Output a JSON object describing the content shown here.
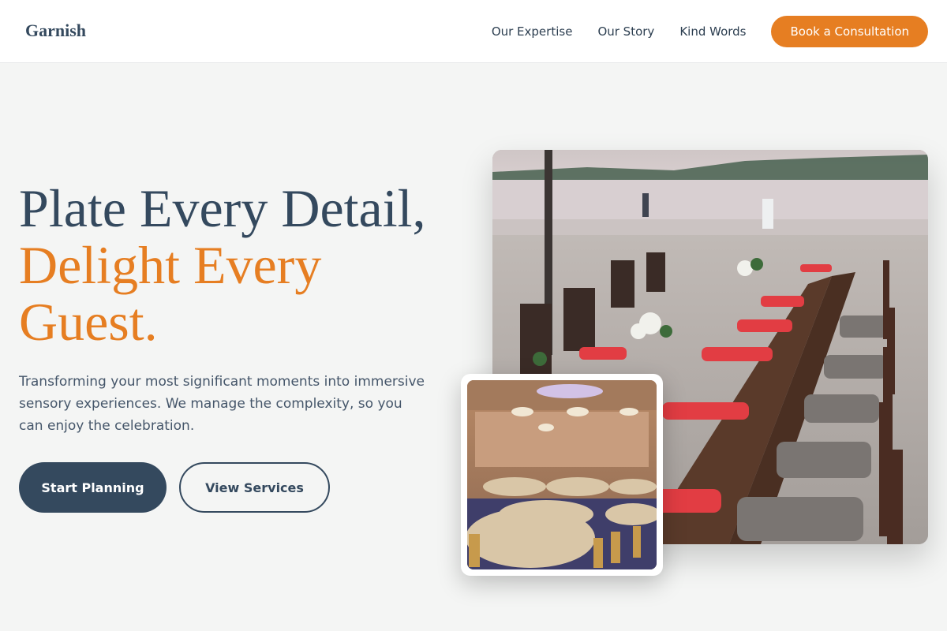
{
  "header": {
    "logo": "Garnish",
    "nav": [
      "Our Expertise",
      "Our Story",
      "Kind Words"
    ],
    "cta": "Book a Consultation"
  },
  "hero": {
    "title_line1": "Plate Every Detail,",
    "title_line2": "Delight Every Guest.",
    "subtitle": "Transforming your most significant moments into immersive sensory experiences. We manage the complexity, so you can enjoy the celebration.",
    "primary_button": "Start Planning",
    "secondary_button": "View Services"
  },
  "images": {
    "main": "beach-dinner-table-photo",
    "secondary": "banquet-hall-photo"
  },
  "colors": {
    "primary": "#34495e",
    "accent": "#e67e22",
    "background": "#f4f5f4"
  }
}
